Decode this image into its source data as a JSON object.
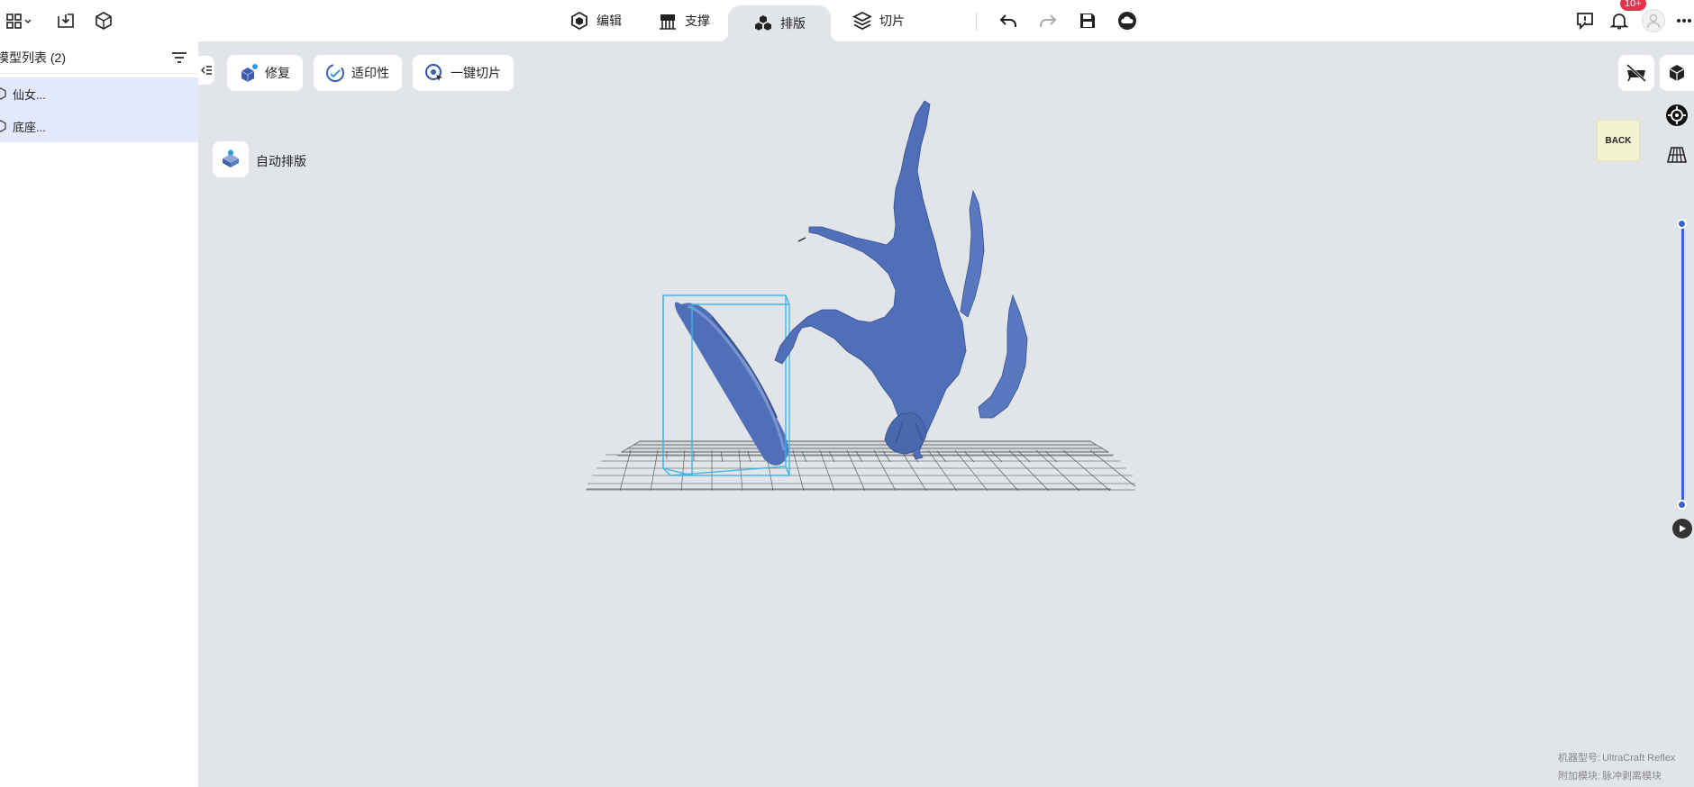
{
  "tabs": [
    {
      "label": "编辑",
      "icon": "cube-outline-icon",
      "active": false
    },
    {
      "label": "支撑",
      "icon": "support-icon",
      "active": false
    },
    {
      "label": "排版",
      "icon": "layout-cubes-icon",
      "active": true
    },
    {
      "label": "切片",
      "icon": "layers-icon",
      "active": false
    }
  ],
  "notifications": {
    "badge": "10+"
  },
  "sidebar": {
    "title": "模型列表 (2)",
    "items": [
      {
        "label": "仙女..."
      },
      {
        "label": "底座..."
      }
    ]
  },
  "toolbar": {
    "repair_label": "修复",
    "fit_label": "适印性",
    "one_click_slice_label": "一键切片",
    "auto_layout_label": "自动排版"
  },
  "view_cube": {
    "face_label": "BACK"
  },
  "machine": {
    "model_key": "机器型号:",
    "model_value": "UltraCraft Reflex",
    "module_key": "附加模块:",
    "module_value": "脉冲剥离模块"
  },
  "colors": {
    "model_blue": "#4f6fb8",
    "selection_box": "#3fb7e8",
    "accent": "#3b63d6",
    "badge_red": "#e8334a"
  }
}
